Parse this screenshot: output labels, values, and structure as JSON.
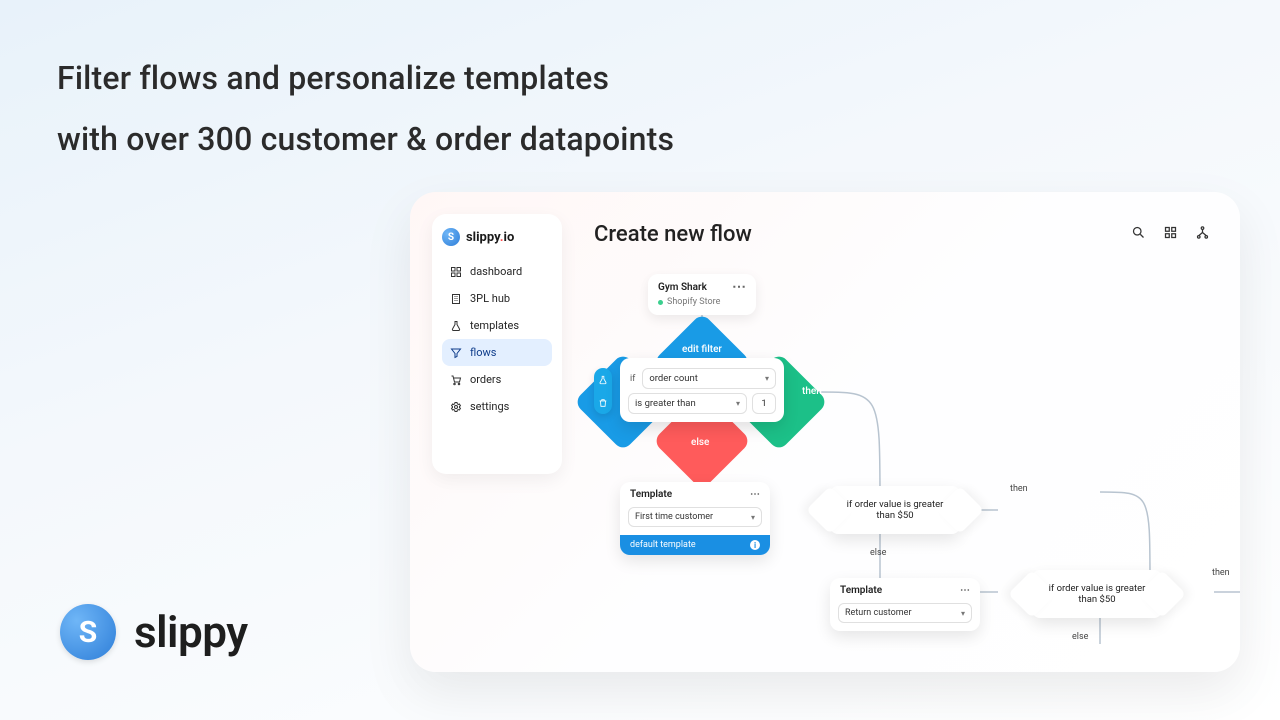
{
  "marketing": {
    "headline_l1": "Filter flows and personalize templates",
    "headline_l2": "with over 300 customer & order datapoints",
    "brand_word": "slippy"
  },
  "app": {
    "brand": {
      "name": "slippy",
      "suffix": "io"
    },
    "nav": [
      {
        "id": "dashboard",
        "label": "dashboard"
      },
      {
        "id": "3pl-hub",
        "label": "3PL hub"
      },
      {
        "id": "templates",
        "label": "templates"
      },
      {
        "id": "flows",
        "label": "flows",
        "active": true
      },
      {
        "id": "orders",
        "label": "orders"
      },
      {
        "id": "settings",
        "label": "settings"
      }
    ],
    "page_title": "Create new flow",
    "trigger": {
      "title": "Gym Shark",
      "subtitle": "Shopify Store"
    },
    "filter": {
      "edit_label": "edit filter",
      "if_label": "if",
      "field": "order count",
      "operator": "is greater than",
      "value": "1",
      "then_label": "then",
      "else_label": "else"
    },
    "templates": {
      "label": "Template",
      "default_label": "default template",
      "first": "First time customer",
      "return": "Return customer"
    },
    "conditions": {
      "order_value": "if order value is greater than $50",
      "then": "then",
      "else": "else"
    }
  }
}
